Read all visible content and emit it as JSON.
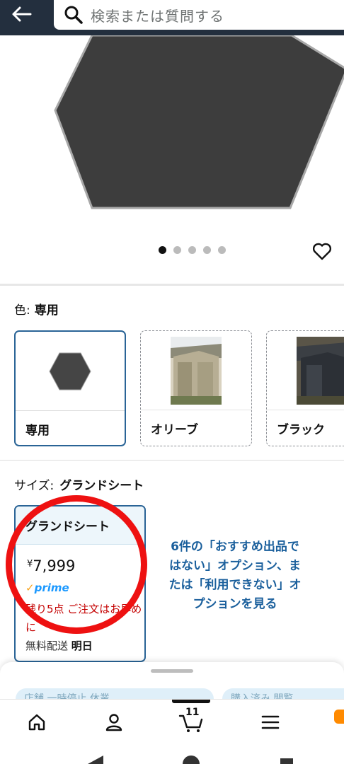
{
  "search": {
    "placeholder": "検索または質問する"
  },
  "gallery": {
    "image_count": 5,
    "active_index": 0
  },
  "color": {
    "label": "色:",
    "selected": "専用",
    "options": [
      {
        "name": "専用"
      },
      {
        "name": "オリーブ"
      },
      {
        "name": "ブラック"
      }
    ]
  },
  "size": {
    "label": "サイズ:",
    "selected": "グランドシート",
    "card": {
      "name": "グランドシート",
      "currency": "¥",
      "price": "7,999",
      "prime": "prime",
      "stock": "残り5点 ご注文はお早めに",
      "shipping_label": "無料配送",
      "shipping_day": "明日"
    },
    "other_options_link": "6件の「おすすめ出品ではない」オプション、または「利用できない」オプションを見る"
  },
  "bottom_bar": {
    "cart_count": "11",
    "pills": [
      "店舗 一時停止 休業",
      "購入済み 閲覧"
    ]
  },
  "colors": {
    "accent_border": "#2a6496",
    "annotation_circle": "#e11111",
    "link": "#1a5f9c",
    "stock": "#c40000",
    "topbar": "#232f3e"
  }
}
